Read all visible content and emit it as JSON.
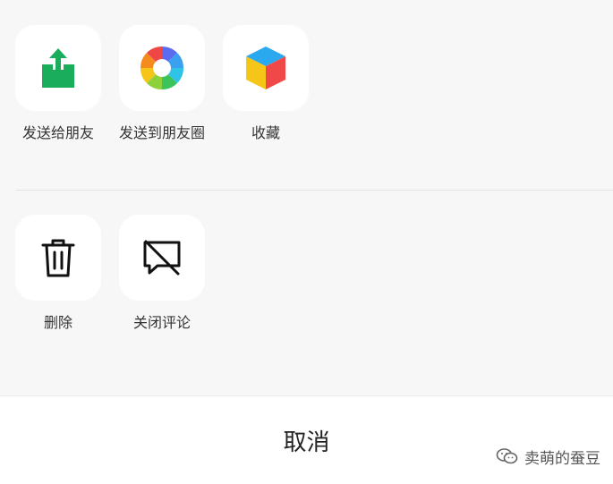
{
  "actions_row1": [
    {
      "label": "发送给朋友",
      "icon": "share-upload-icon"
    },
    {
      "label": "发送到朋友圈",
      "icon": "moments-shutter-icon"
    },
    {
      "label": "收藏",
      "icon": "favorite-cube-icon"
    }
  ],
  "actions_row2": [
    {
      "label": "删除",
      "icon": "trash-icon"
    },
    {
      "label": "关闭评论",
      "icon": "comment-off-icon"
    }
  ],
  "cancel_label": "取消",
  "watermark": {
    "text": "卖萌的蚕豆",
    "icon": "wechat-logo-icon"
  },
  "colors": {
    "share_green": "#1aad5c",
    "background": "#f7f7f7",
    "tile": "#ffffff"
  }
}
